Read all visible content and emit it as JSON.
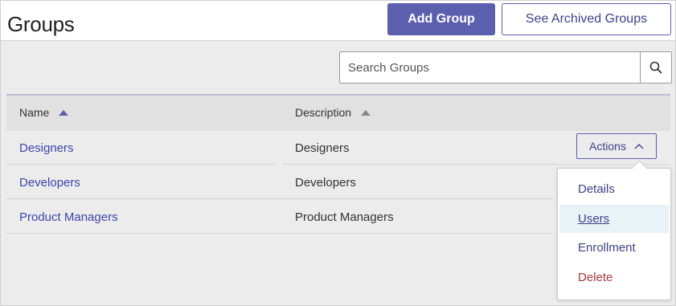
{
  "header": {
    "title": "Groups",
    "add_group_label": "Add Group",
    "archived_label": "See Archived Groups"
  },
  "search": {
    "placeholder": "Search Groups",
    "value": "",
    "icon": "search-icon"
  },
  "table": {
    "columns": [
      {
        "label": "Name",
        "sort": "ascending",
        "sort_color": "#5b5fae"
      },
      {
        "label": "Description",
        "sort": "ascending",
        "sort_color": "#888888"
      }
    ],
    "rows": [
      {
        "name": "Designers",
        "description": "Designers"
      },
      {
        "name": "Developers",
        "description": "Developers"
      },
      {
        "name": "Product Managers",
        "description": "Product Managers"
      }
    ]
  },
  "actions": {
    "label": "Actions",
    "icon": "chevron-up-icon",
    "menu": [
      {
        "label": "Details",
        "state": "normal"
      },
      {
        "label": "Users",
        "state": "hover"
      },
      {
        "label": "Enrollment",
        "state": "normal"
      },
      {
        "label": "Delete",
        "state": "danger"
      }
    ]
  },
  "colors": {
    "brand": "#5b5fae",
    "link": "#3d45a8",
    "danger": "#a3383c",
    "hover_bg": "#e8f3f8"
  }
}
